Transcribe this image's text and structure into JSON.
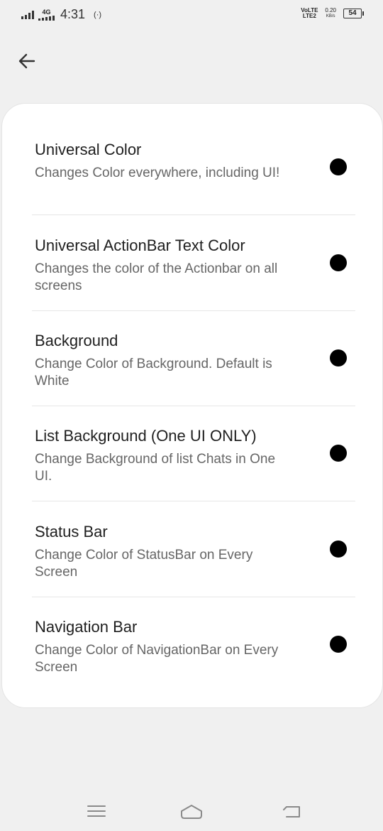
{
  "status_bar": {
    "network": "4G",
    "time": "4:31",
    "hotspot": "(·)",
    "volte_line1": "VoLTE",
    "volte_line2": "LTE2",
    "speed_value": "0.20",
    "speed_unit": "KB/s",
    "battery": "54"
  },
  "items": [
    {
      "title": "Universal Color",
      "subtitle": "Changes Color everywhere, including UI!",
      "color": "#000000"
    },
    {
      "title": "Universal ActionBar Text Color",
      "subtitle": "Changes the color of the Actionbar on all screens",
      "color": "#000000"
    },
    {
      "title": "Background",
      "subtitle": "Change Color of Background. Default is White",
      "color": "#000000"
    },
    {
      "title": "List Background (One UI ONLY)",
      "subtitle": "Change Background of list Chats in One UI.",
      "color": "#000000"
    },
    {
      "title": "Status Bar",
      "subtitle": "Change Color of StatusBar on Every Screen",
      "color": "#000000"
    },
    {
      "title": "Navigation Bar",
      "subtitle": "Change Color of NavigationBar on Every Screen",
      "color": "#000000"
    }
  ],
  "icons": {
    "back": "arrow-left-icon",
    "nav_menu": "menu-lines-icon",
    "nav_home": "home-icon",
    "nav_back": "return-icon"
  }
}
